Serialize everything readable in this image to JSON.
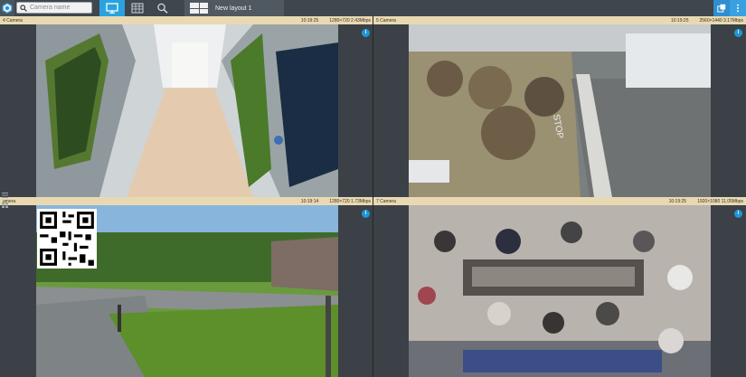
{
  "toolbar": {
    "search_placeholder": "Camera name",
    "layout_tab": "New layout 1"
  },
  "icons": {
    "logo": "app-logo-icon",
    "search": "magnifier-icon",
    "monitor": "monitor-icon",
    "archive": "archive-grid-icon",
    "analytics": "search-analytics-icon",
    "layout": "layout-grid-icon",
    "export": "export-window-icon",
    "menu": "vertical-dots-icon",
    "info": "info-icon"
  },
  "colors": {
    "accent": "#29a3dd",
    "camera_header": "#e9d9b2",
    "info_badge": "#1e96d8"
  },
  "cameras": [
    {
      "name": "4 Camera",
      "time": "10:19:25",
      "resolution": "1280×720 2.43Mbps"
    },
    {
      "name": "5 Camera",
      "time": "10:19:25",
      "resolution": "2560×1440 3.17Mbps"
    },
    {
      "name": "amera",
      "time": "10:19:14",
      "resolution": "1280×720 1.73Mbps"
    },
    {
      "name": "7 Camera",
      "time": "10:19:25",
      "resolution": "1920×1080 11.05Mbps"
    }
  ]
}
